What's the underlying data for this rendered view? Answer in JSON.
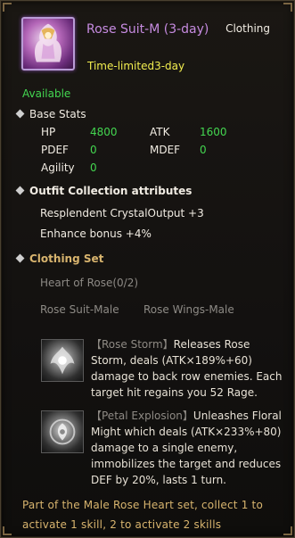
{
  "item": {
    "name": "Rose Suit-M (3-day)",
    "type": "Clothing",
    "time_limit": "Time-limited3-day",
    "status": "Available",
    "icon": "rose-suit-icon"
  },
  "base_stats": {
    "title": "Base Stats",
    "hp_label": "HP",
    "hp_value": "4800",
    "atk_label": "ATK",
    "atk_value": "1600",
    "pdef_label": "PDEF",
    "pdef_value": "0",
    "mdef_label": "MDEF",
    "mdef_value": "0",
    "agility_label": "Agility",
    "agility_value": "0"
  },
  "collection": {
    "title": "Outfit Collection attributes",
    "lines": [
      "Resplendent CrystalOutput +3",
      "Enhance bonus +4%"
    ]
  },
  "clothing_set": {
    "title": "Clothing Set",
    "set_name": "Heart of Rose(0/2)",
    "pieces": [
      "Rose Suit-Male",
      "Rose Wings-Male"
    ],
    "skills": [
      {
        "name": "【Rose Storm】",
        "desc": "Releases Rose Storm, deals (ATK×189%+60) damage to back row enemies. Each target hit regains you 52 Rage.",
        "icon": "rose-storm-icon"
      },
      {
        "name": "【Petal Explosion】",
        "desc": "Unleashes Floral Might which deals (ATK×233%+80) damage to a single enemy, immobilizes the target and reduces DEF by 20%, lasts 1 turn.",
        "icon": "petal-explosion-icon"
      }
    ],
    "note": "Part of the Male Rose Heart set, collect 1 to activate 1 skill, 2 to activate 2 skills"
  },
  "colors": {
    "name": "#c68be0",
    "available": "#43d650",
    "time_limit": "#f2ee4f",
    "set_title": "#d8b46e",
    "inactive": "#8d8a85"
  }
}
